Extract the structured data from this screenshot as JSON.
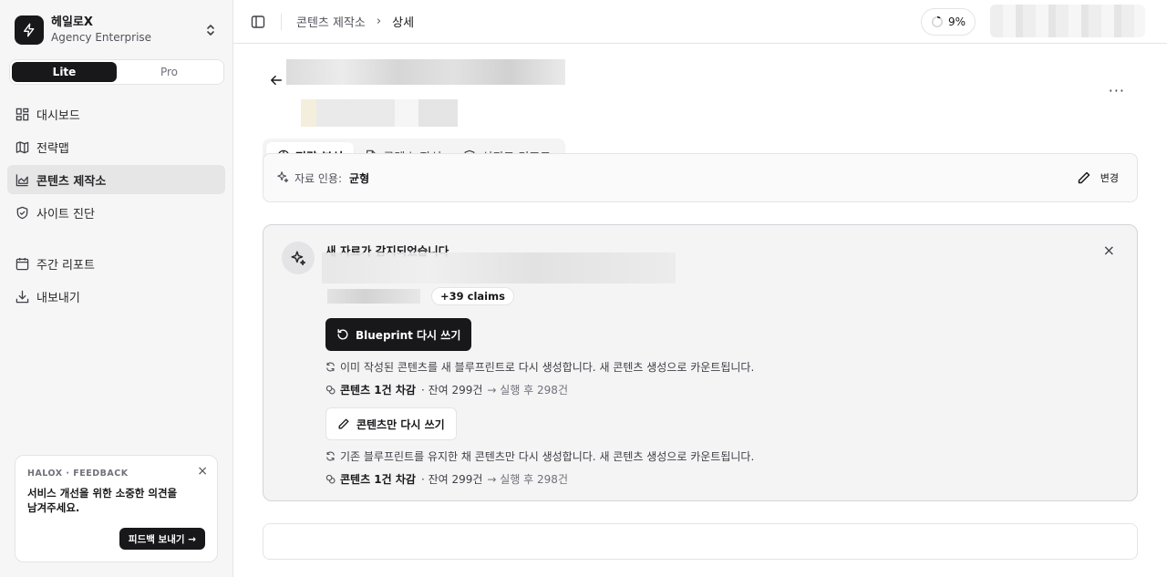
{
  "brand": {
    "name": "헤일로X",
    "plan": "Agency Enterprise"
  },
  "plan_toggle": {
    "lite": "Lite",
    "pro": "Pro"
  },
  "nav": {
    "items": [
      {
        "label": "대시보드"
      },
      {
        "label": "전략맵"
      },
      {
        "label": "콘텐츠 제작소"
      },
      {
        "label": "사이트 진단"
      },
      {
        "label": "주간 리포트"
      },
      {
        "label": "내보내기"
      }
    ]
  },
  "feedback": {
    "title": "HALOX · FEEDBACK",
    "text": "서비스 개선을 위한 소중한 의견을 남겨주세요.",
    "button": "피드백 보내기 →",
    "close": "×"
  },
  "topbar": {
    "breadcrumb": [
      "콘텐츠 제작소",
      "상세"
    ],
    "separator": "›",
    "progress": "9%"
  },
  "header": {
    "more": "···"
  },
  "tabs": [
    {
      "label": "전략 분석"
    },
    {
      "label": "콘텐츠 작성"
    },
    {
      "label": "신뢰도 리포트"
    }
  ],
  "citation": {
    "label": "자료 인용:",
    "value": "균형",
    "edit": "변경"
  },
  "alert": {
    "title": "새 자료가 감지되었습니다",
    "claims": "+39 claims",
    "close": "×",
    "blueprint_button": "Blueprint 다시 쓰기",
    "blueprint_desc": "이미 작성된 콘텐츠를 새 블루프린트로 다시 생성합니다. 새 콘텐츠 생성으로 카운트됩니다.",
    "content_button": "콘텐츠만 다시 쓰기",
    "content_desc": "기존 블루프린트를 유지한 채 콘텐츠만 다시 생성합니다. 새 콘텐츠 생성으로 카운트됩니다.",
    "cost_1": {
      "cost": "콘텐츠 1건 차감",
      "remain": "· 잔여 299건",
      "after": "→ 실행 후 298건"
    },
    "cost_2": {
      "cost": "콘텐츠 1건 차감",
      "remain": "· 잔여 299건",
      "after": "→ 실행 후 298건"
    }
  }
}
